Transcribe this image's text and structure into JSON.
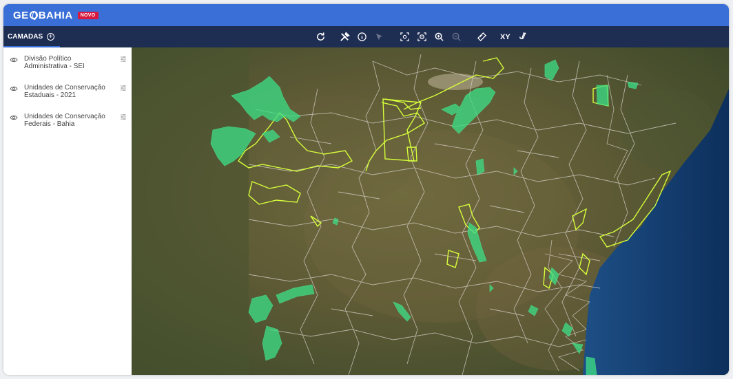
{
  "app": {
    "logo_text_left": "GE",
    "logo_text_right": "BAHIA",
    "badge": "NOVO"
  },
  "panel": {
    "tab_label": "CAMADAS",
    "add_icon": "plus-circle-icon"
  },
  "toolbar": {
    "icons": [
      "refresh-icon",
      "tools-icon",
      "info-icon",
      "select-arrow-icon",
      "zoom-extent-icon",
      "zoom-region-icon",
      "zoom-in-icon",
      "zoom-out-icon",
      "measure-icon",
      "coordinates-icon",
      "draw-icon"
    ],
    "coord_label": "XY"
  },
  "layers": [
    {
      "name": "Divisão Político Administrativa - SEI",
      "visible": true
    },
    {
      "name": "Unidades de Conservação Estaduais - 2021",
      "visible": true
    },
    {
      "name": "Unidades de Conservação Federais - Bahia",
      "visible": true
    }
  ],
  "colors": {
    "header": "#3a6fd8",
    "toolbar": "#1e2d52",
    "badge": "#d8183c",
    "federal_units": "#3ddc84",
    "state_units": "#d7ff3a"
  }
}
